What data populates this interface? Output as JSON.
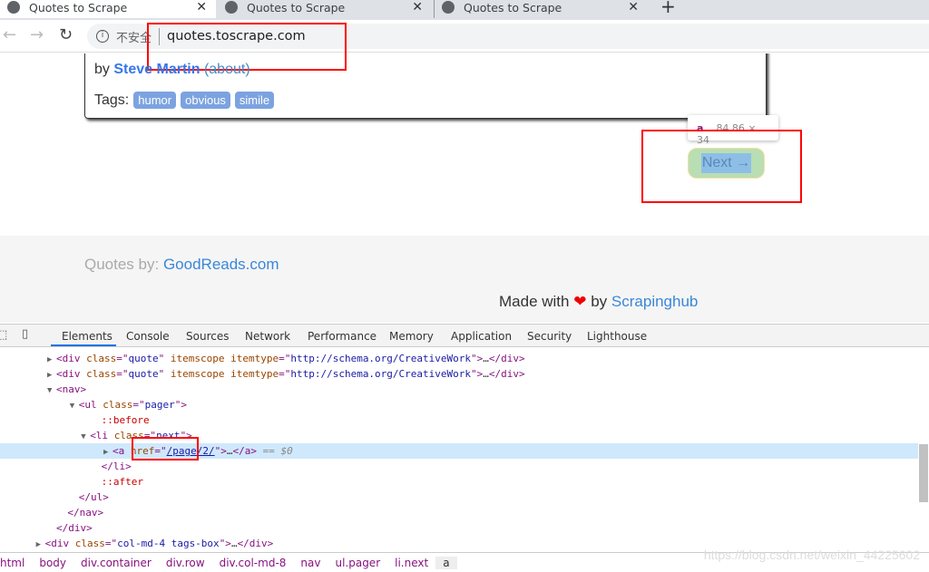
{
  "browser": {
    "tabs": [
      {
        "title": "Quotes to Scrape",
        "active": true
      },
      {
        "title": "Quotes to Scrape",
        "active": false
      },
      {
        "title": "Quotes to Scrape",
        "active": false
      }
    ],
    "new_tab": "+",
    "security_label": "不安全",
    "url": "quotes.toscrape.com"
  },
  "page": {
    "by": "by",
    "author": "Steve Martin",
    "about": "(about)",
    "tags_label": "Tags:",
    "tags": [
      "humor",
      "obvious",
      "simile"
    ],
    "tooltip_tag": "a",
    "tooltip_size": "84.86 × 34",
    "next": "Next →",
    "footer_prefix": "Quotes by:",
    "footer_link": "GoodReads.com",
    "made_with": "Made with",
    "heart": "❤",
    "made_by": "by",
    "made_link": "Scrapinghub"
  },
  "devtools": {
    "tabs": [
      "Elements",
      "Console",
      "Sources",
      "Network",
      "Performance",
      "Memory",
      "Application",
      "Security",
      "Lighthouse"
    ],
    "active_tab": "Elements",
    "tree": [
      {
        "indent": 5,
        "arrow": "▶",
        "parts": [
          [
            "tg",
            "<div "
          ],
          [
            "at",
            "class"
          ],
          [
            "tg",
            "=\""
          ],
          [
            "av",
            "quote"
          ],
          [
            "tg",
            "\" "
          ],
          [
            "at",
            "itemscope itemtype"
          ],
          [
            "tg",
            "=\""
          ],
          [
            "av",
            "http://schema.org/CreativeWork"
          ],
          [
            "tg",
            "\">"
          ],
          [
            "tx",
            "…"
          ],
          [
            "tg",
            "</div>"
          ]
        ]
      },
      {
        "indent": 5,
        "arrow": "▶",
        "parts": [
          [
            "tg",
            "<div "
          ],
          [
            "at",
            "class"
          ],
          [
            "tg",
            "=\""
          ],
          [
            "av",
            "quote"
          ],
          [
            "tg",
            "\" "
          ],
          [
            "at",
            "itemscope itemtype"
          ],
          [
            "tg",
            "=\""
          ],
          [
            "av",
            "http://schema.org/CreativeWork"
          ],
          [
            "tg",
            "\">"
          ],
          [
            "tx",
            "…"
          ],
          [
            "tg",
            "</div>"
          ]
        ]
      },
      {
        "indent": 5,
        "arrow": "▼",
        "parts": [
          [
            "tg",
            "<nav>"
          ]
        ]
      },
      {
        "indent": 7,
        "arrow": "▼",
        "parts": [
          [
            "tg",
            "<ul "
          ],
          [
            "at",
            "class"
          ],
          [
            "tg",
            "=\""
          ],
          [
            "av",
            "pager"
          ],
          [
            "tg",
            "\">"
          ]
        ]
      },
      {
        "indent": 9,
        "arrow": "",
        "parts": [
          [
            "ps",
            "::before"
          ]
        ]
      },
      {
        "indent": 8,
        "arrow": "▼",
        "parts": [
          [
            "tg",
            "<li "
          ],
          [
            "at",
            "class"
          ],
          [
            "tg",
            "=\""
          ],
          [
            "av",
            "next"
          ],
          [
            "tg",
            "\">"
          ]
        ]
      },
      {
        "indent": 10,
        "arrow": "▶",
        "selected": true,
        "parts": [
          [
            "tg",
            "<a "
          ],
          [
            "at",
            "href"
          ],
          [
            "tg",
            "=\""
          ],
          [
            "lk",
            "/page/2/"
          ],
          [
            "tg",
            "\">"
          ],
          [
            "tx",
            "…"
          ],
          [
            "tg",
            "</a>"
          ],
          [
            "dim",
            " == $0"
          ]
        ]
      },
      {
        "indent": 9,
        "arrow": "",
        "parts": [
          [
            "tg",
            "</li>"
          ]
        ]
      },
      {
        "indent": 9,
        "arrow": "",
        "parts": [
          [
            "ps",
            "::after"
          ]
        ]
      },
      {
        "indent": 7,
        "arrow": "",
        "parts": [
          [
            "tg",
            "</ul>"
          ]
        ]
      },
      {
        "indent": 6,
        "arrow": "",
        "parts": [
          [
            "tg",
            "</nav>"
          ]
        ]
      },
      {
        "indent": 5,
        "arrow": "",
        "parts": [
          [
            "tg",
            "</div>"
          ]
        ]
      },
      {
        "indent": 4,
        "arrow": "▶",
        "parts": [
          [
            "tg",
            "<div "
          ],
          [
            "at",
            "class"
          ],
          [
            "tg",
            "=\""
          ],
          [
            "av",
            "col-md-4 tags-box"
          ],
          [
            "tg",
            "\">"
          ],
          [
            "tx",
            "…"
          ],
          [
            "tg",
            "</div>"
          ]
        ]
      }
    ],
    "breadcrumbs": [
      "html",
      "body",
      "div.container",
      "div.row",
      "div.col-md-8",
      "nav",
      "ul.pager",
      "li.next",
      "a"
    ]
  },
  "watermark": "https://blog.csdn.net/weixin_44225602"
}
